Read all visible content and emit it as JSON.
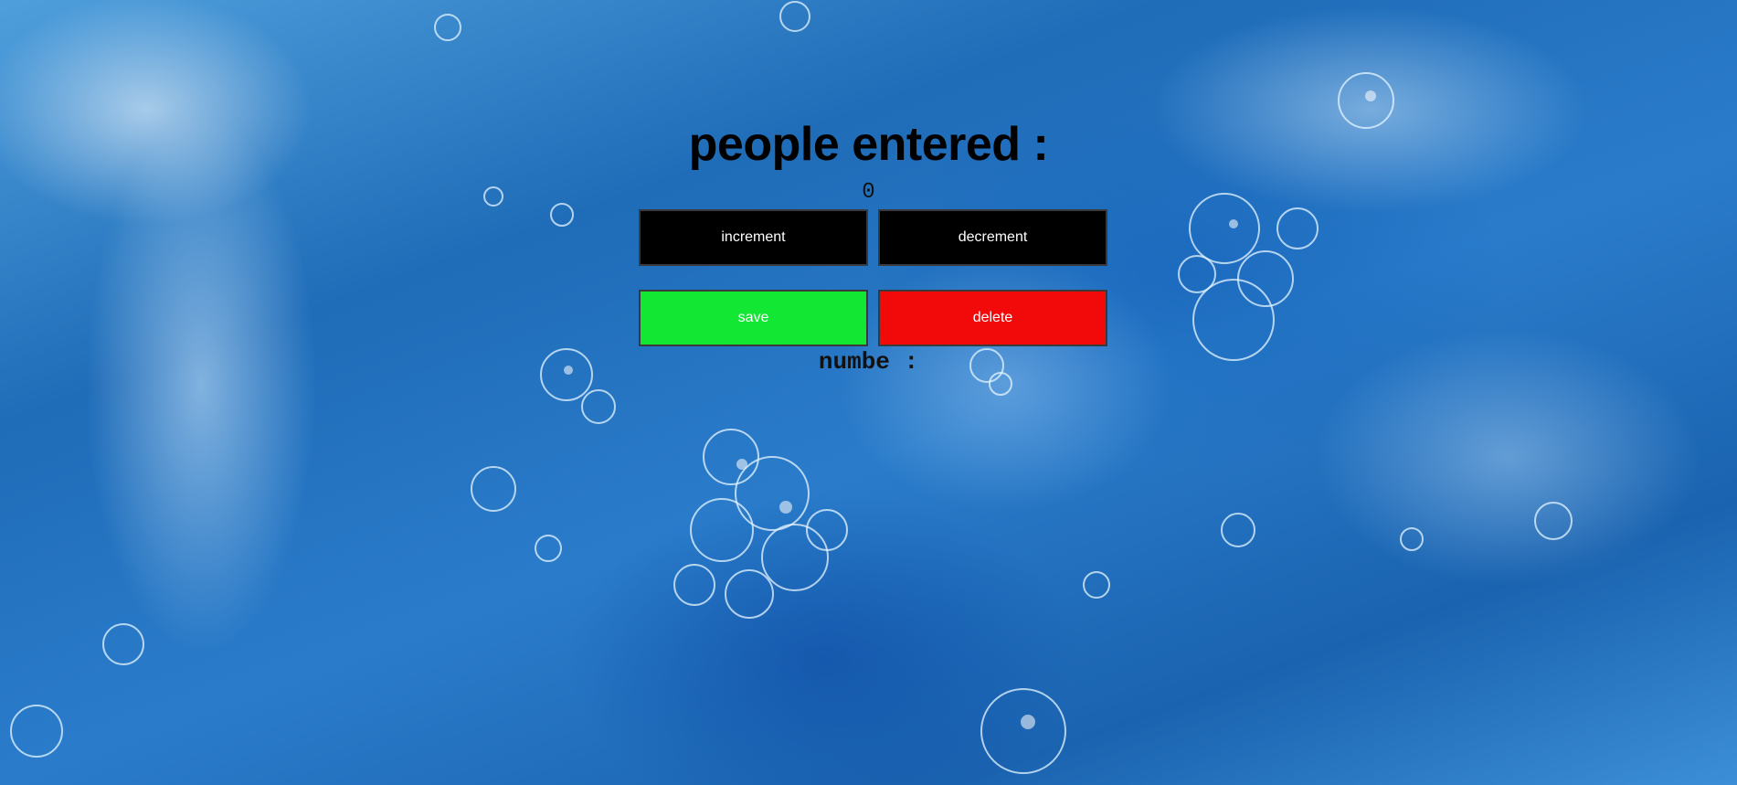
{
  "page": {
    "background": "water-bubbles-image",
    "title": "people entered :",
    "count": "0",
    "saved_label": "numbe :"
  },
  "buttons": {
    "increment": "increment",
    "decrement": "decrement",
    "save": "save",
    "delete": "delete"
  },
  "colors": {
    "increment_bg": "#000000",
    "decrement_bg": "#000000",
    "save_bg": "#12e834",
    "delete_bg": "#f20a0a"
  }
}
